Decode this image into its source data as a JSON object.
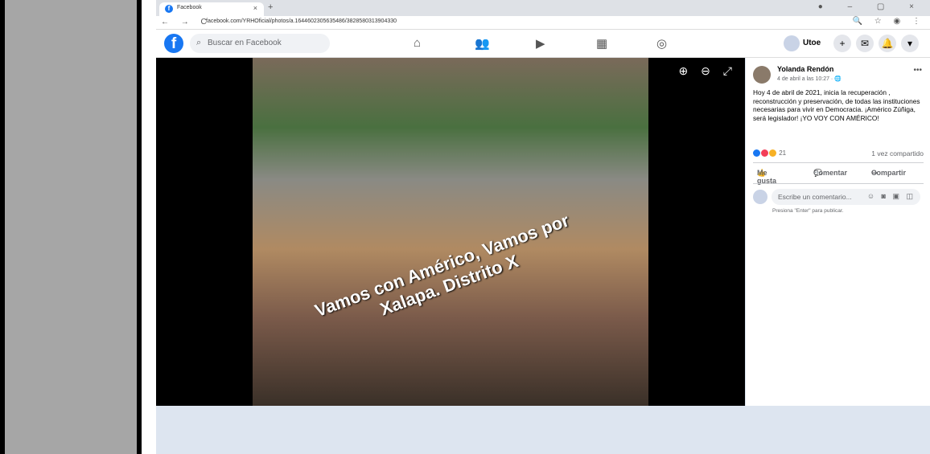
{
  "browser": {
    "tab_title": "Facebook",
    "url": "facebook.com/YRHOficial/photos/a.1644602305635486/3828580313904330"
  },
  "facebook": {
    "search_placeholder": "Buscar en Facebook",
    "user_name": "Utoe"
  },
  "photo": {
    "caption_line1": "Vamos con Américo, Vamos por",
    "caption_line2": "Xalapa. Distrito X"
  },
  "post": {
    "author": "Yolanda Rendón",
    "date": "4 de abril a las 10:27 · 🌐",
    "text": "Hoy 4 de abril de 2021, inicia la recuperación , reconstrucción y preservación, de todas las instituciones necesarias para vivir en Democracia. ¡Américo Zúñiga, será legislador! ¡YO VOY CON AMÉRICO!",
    "reaction_count": "21",
    "shared": "1 vez compartido",
    "like_label": "Me gusta",
    "comment_label": "Comentar",
    "share_label": "Compartir",
    "comment_placeholder": "Escribe un comentario...",
    "comment_hint": "Presiona \"Enter\" para publicar."
  },
  "colors": {
    "fb_blue": "#1877f2",
    "gutter_gray": "#a6a6a6"
  }
}
